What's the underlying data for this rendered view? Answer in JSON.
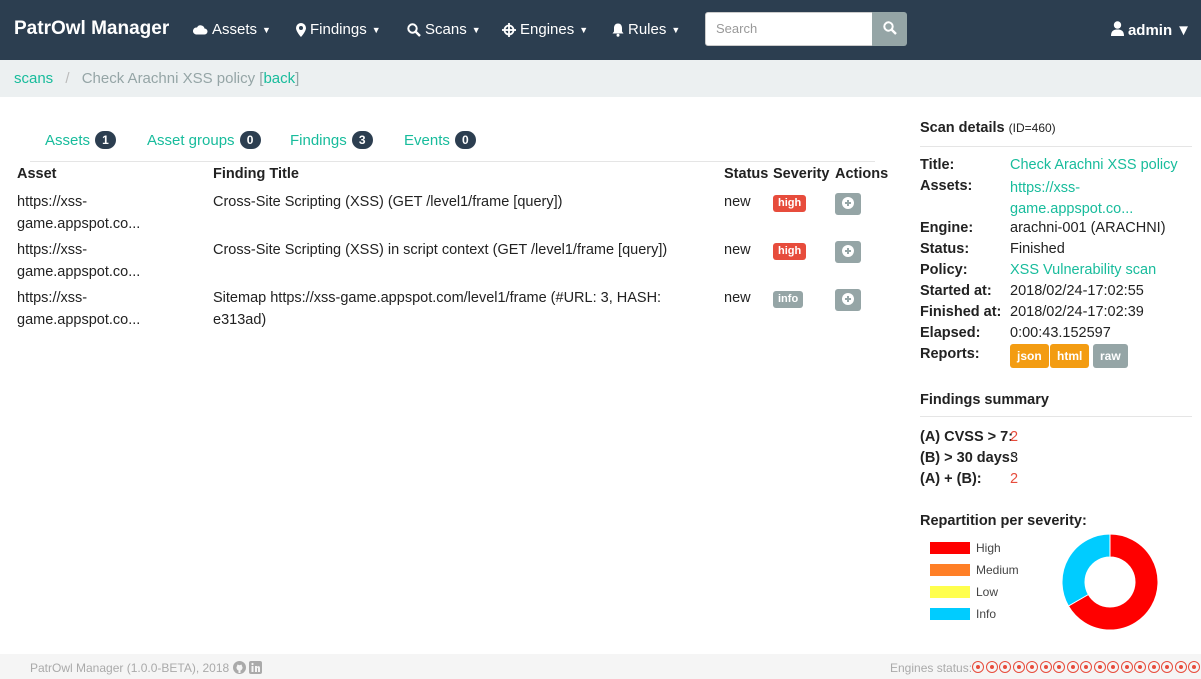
{
  "navbar": {
    "brand": "PatrOwl Manager",
    "menus": [
      {
        "label": "Assets",
        "icon": "cloud-icon"
      },
      {
        "label": "Findings",
        "icon": "map-marker-icon"
      },
      {
        "label": "Scans",
        "icon": "search-icon"
      },
      {
        "label": "Engines",
        "icon": "crosshair-icon"
      },
      {
        "label": "Rules",
        "icon": "bell-icon"
      }
    ],
    "search_placeholder": "Search",
    "user": "admin"
  },
  "breadcrumb": {
    "root": "scans",
    "separator": "/",
    "current": "Check Arachni XSS policy",
    "back_open": "[",
    "back": "back",
    "back_close": "]"
  },
  "tabs": [
    {
      "label": "Assets",
      "count": "1"
    },
    {
      "label": "Asset groups",
      "count": "0"
    },
    {
      "label": "Findings",
      "count": "3"
    },
    {
      "label": "Events",
      "count": "0"
    }
  ],
  "table": {
    "headers": {
      "asset": "Asset",
      "title": "Finding Title",
      "status": "Status",
      "severity": "Severity",
      "actions": "Actions"
    },
    "rows": [
      {
        "asset_l1": "https://xss-",
        "asset_l2": "game.appspot.co...",
        "title_l1": "Cross-Site Scripting (XSS) (GET /level1/frame [query])",
        "title_l2": "",
        "status": "new",
        "severity": "high"
      },
      {
        "asset_l1": "https://xss-",
        "asset_l2": "game.appspot.co...",
        "title_l1": "Cross-Site Scripting (XSS) in script context (GET /level1/frame [query])",
        "title_l2": "",
        "status": "new",
        "severity": "high"
      },
      {
        "asset_l1": "https://xss-",
        "asset_l2": "game.appspot.co...",
        "title_l1": "Sitemap https://xss-game.appspot.com/level1/frame (#URL: 3, HASH:",
        "title_l2": "e313ad)",
        "status": "new",
        "severity": "info"
      }
    ]
  },
  "scan_details": {
    "heading": "Scan details",
    "id_note": "(ID=460)",
    "title_label": "Title:",
    "title": "Check Arachni XSS policy",
    "assets_label": "Assets:",
    "assets_l1": "https://xss-",
    "assets_l2": "game.appspot.co...",
    "engine_label": "Engine:",
    "engine": "arachni-001 (ARACHNI)",
    "status_label": "Status:",
    "status": "Finished",
    "policy_label": "Policy:",
    "policy": "XSS Vulnerability scan",
    "started_label": "Started at:",
    "started": "2018/02/24-17:02:55",
    "finished_label": "Finished at:",
    "finished": "2018/02/24-17:02:39",
    "elapsed_label": "Elapsed:",
    "elapsed": "0:00:43.152597",
    "reports_label": "Reports:",
    "reports": [
      "json",
      "html",
      "raw"
    ]
  },
  "findings_summary": {
    "heading": "Findings summary",
    "cvss_label": "(A) CVSS > 7:",
    "cvss": "2",
    "days_label": "(B) > 30 days:",
    "days": "3",
    "ab_label": "(A) + (B):",
    "ab": "2"
  },
  "severity": {
    "heading": "Repartition per severity:",
    "legend": [
      {
        "label": "High",
        "color": "#ff0000"
      },
      {
        "label": "Medium",
        "color": "#ff7f27"
      },
      {
        "label": "Low",
        "color": "#ffff4d"
      },
      {
        "label": "Info",
        "color": "#00ccff"
      }
    ]
  },
  "chart_data": {
    "type": "pie",
    "categories": [
      "High",
      "Medium",
      "Low",
      "Info"
    ],
    "values": [
      2,
      0,
      0,
      1
    ],
    "colors": [
      "#ff0000",
      "#ff7f27",
      "#ffff4d",
      "#00ccff"
    ]
  },
  "footer": {
    "text": "PatrOwl Manager (1.0.0-BETA), 2018",
    "engines_label": "Engines status:",
    "engine_colors": [
      "#e74c3c",
      "#e74c3c",
      "#e74c3c",
      "#e74c3c",
      "#e74c3c",
      "#e74c3c",
      "#e74c3c",
      "#e74c3c",
      "#e74c3c",
      "#e74c3c",
      "#e74c3c",
      "#e74c3c",
      "#e74c3c",
      "#e74c3c",
      "#e74c3c",
      "#e74c3c",
      "#e74c3c",
      "#bbbbbb",
      "#bbbbbb",
      "#bbbbbb"
    ]
  }
}
